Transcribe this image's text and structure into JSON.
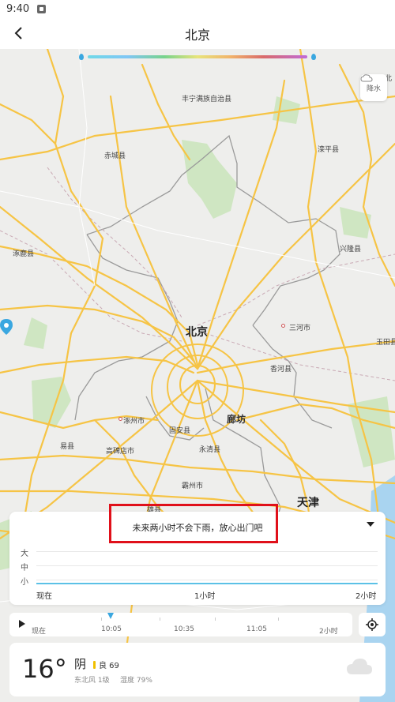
{
  "status_bar": {
    "time": "9:40"
  },
  "header": {
    "title": "北京"
  },
  "map": {
    "layer_button_label": "降水",
    "labels": {
      "fengning": "丰宁满族自治县",
      "huabei": "化北",
      "chicheng": "赤城县",
      "luanping": "滦平县",
      "zhuolu": "涿鹿县",
      "xinglong": "兴隆县",
      "beijing": "北京",
      "sanhe": "三河市",
      "yutian": "玉田县",
      "xianghe": "香河县",
      "langfang": "廊坊",
      "zhuozhou": "涿州市",
      "guan": "固安县",
      "yixian": "易县",
      "gaobeidian": "高碑店市",
      "yongqing": "永清县",
      "bazhou": "霸州市",
      "xiongxian": "雄县",
      "tianjin": "天津"
    }
  },
  "rain_card": {
    "forecast_text": "未来两小时不会下雨，放心出门吧",
    "y_labels": [
      "大",
      "中",
      "小"
    ],
    "x_labels": [
      "现在",
      "1小时",
      "2小时"
    ]
  },
  "timeline": {
    "labels": [
      "现在",
      "10:05",
      "10:35",
      "11:05",
      "2小时"
    ]
  },
  "weather": {
    "temperature": "16°",
    "condition": "阴",
    "aqi": "良 69",
    "wind": "东北风 1级",
    "humidity": "湿度 79%"
  },
  "colors": {
    "accent": "#3aa7e0",
    "highlight": "#e0101a",
    "road": "#f6c445"
  }
}
